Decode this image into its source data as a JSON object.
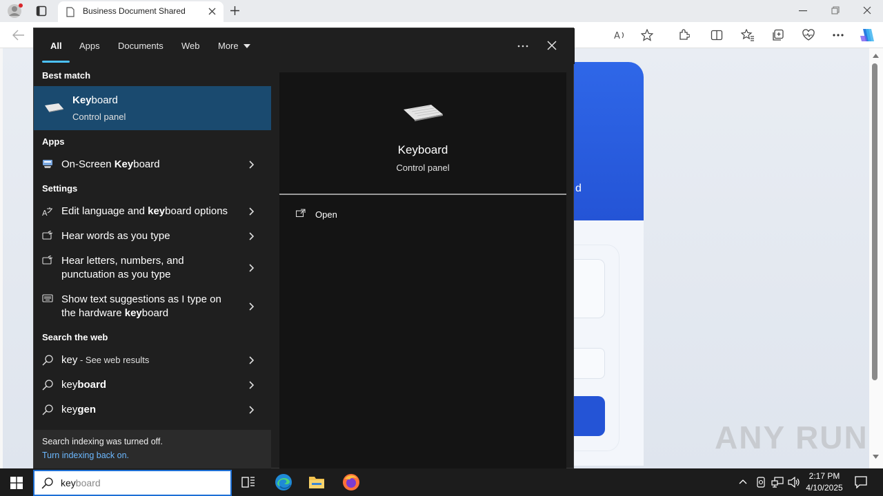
{
  "browser": {
    "tab_title": "Business Document Shared",
    "page_card_letter": "d"
  },
  "search_panel": {
    "filters": [
      "All",
      "Apps",
      "Documents",
      "Web",
      "More"
    ],
    "active_filter": "All",
    "best_match_header": "Best match",
    "best_match": {
      "title_bold": "Key",
      "title_rest": "board",
      "subtitle": "Control panel"
    },
    "apps_header": "Apps",
    "apps": [
      {
        "pre": "On-Screen ",
        "bold": "Key",
        "post": "board"
      }
    ],
    "settings_header": "Settings",
    "settings": [
      {
        "line1_pre": "Edit language and ",
        "line1_bold": "key",
        "line1_post": "board options",
        "line2": ""
      },
      {
        "line1_pre": "Hear words as you type",
        "line1_bold": "",
        "line1_post": "",
        "line2": ""
      },
      {
        "line1_pre": "Hear letters, numbers, and",
        "line1_bold": "",
        "line1_post": "",
        "line2": "punctuation as you type"
      },
      {
        "line1_pre": "Show text suggestions as I type on",
        "line1_bold": "",
        "line1_post": "",
        "line2_pre": "the hardware ",
        "line2_bold": "key",
        "line2_post": "board"
      }
    ],
    "web_header": "Search the web",
    "web_results": [
      {
        "bold": "key",
        "rest": "",
        "suffix": " - See web results"
      },
      {
        "bold": "key",
        "rest": "board",
        "suffix": ""
      },
      {
        "bold": "key",
        "rest": "gen",
        "suffix": ""
      }
    ],
    "footer": {
      "note": "Search indexing was turned off.",
      "link": "Turn indexing back on."
    },
    "preview": {
      "title": "Keyboard",
      "subtitle": "Control panel",
      "action": "Open"
    }
  },
  "taskbar": {
    "search_typed": "key",
    "search_suggest": "board",
    "time": "2:17 PM",
    "date": "4/10/2025"
  },
  "watermark": "ANY RUN",
  "colors": {
    "accent": "#4cc2ff",
    "best_match_bg": "#1a4a6f",
    "link": "#6cb8ff"
  }
}
